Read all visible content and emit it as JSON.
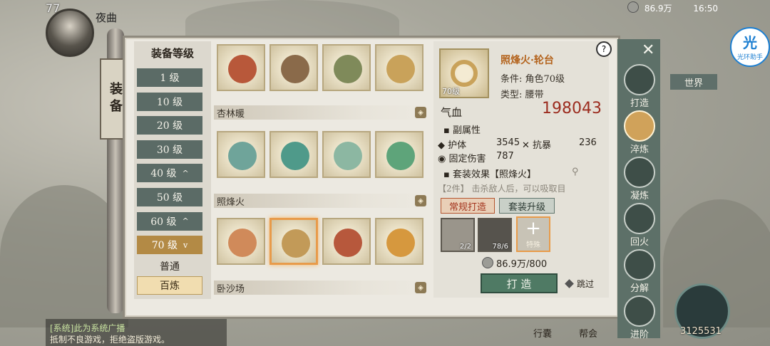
{
  "hud": {
    "player_level": "77",
    "player_name": "夜曲",
    "silver": "86.9万",
    "time": "16:50",
    "world_label": "世界",
    "helper_label": "光环助手",
    "helper_glyph": "光",
    "power_value": "3125531"
  },
  "scroll_tab": {
    "label": "装备"
  },
  "left_panel": {
    "title": "装备等级",
    "levels": [
      {
        "label": "1 级",
        "chevron": ""
      },
      {
        "label": "10 级",
        "chevron": ""
      },
      {
        "label": "20 级",
        "chevron": ""
      },
      {
        "label": "30 级",
        "chevron": ""
      },
      {
        "label": "40 级",
        "chevron": "^"
      },
      {
        "label": "50 级",
        "chevron": ""
      },
      {
        "label": "60 级",
        "chevron": "^"
      },
      {
        "label": "70 级",
        "chevron": "v"
      }
    ],
    "quality_label": "普通",
    "quality_selected": "百炼"
  },
  "sets": [
    {
      "name": "",
      "items": [
        "red-shoulder-armor",
        "bronze-belt",
        "green-boots",
        "gold-ring"
      ]
    },
    {
      "name": "杏林暖",
      "items": [
        "teal-robe",
        "teal-belt",
        "teal-boots",
        "jade-ring"
      ]
    },
    {
      "name": "照烽火",
      "items": [
        "orange-robe",
        "tassel-belt",
        "red-boots",
        "amber-ring"
      ]
    },
    {
      "name": "卧沙场",
      "items": []
    }
  ],
  "detail": {
    "item_name": "照烽火·轮台",
    "condition": "条件: 角色70级",
    "type": "类型: 腰带",
    "item_level": "70级",
    "qixue_label": "气血",
    "qixue_value": "198043",
    "sub_attr_title": "副属性",
    "attrs": [
      {
        "name": "护体",
        "value": "3545"
      },
      {
        "name": "抗暴",
        "value": "236"
      },
      {
        "name": "固定伤害",
        "value": "787"
      }
    ],
    "set_effect_title": "套装效果【照烽火】",
    "set_effect_desc": "【2件】 击杀敌人后，可以吸取目",
    "tab_normal": "常规打造",
    "tab_upgrade": "套装升级",
    "materials": [
      {
        "name": "iron-ingot",
        "count": "2/2"
      },
      {
        "name": "ore-stone",
        "count": "78/6"
      }
    ],
    "special_label": "特殊",
    "cost": "86.9万/800",
    "forge_button": "打 造",
    "skip_label": "跳过"
  },
  "side_menu": [
    {
      "label": "打造",
      "active": false
    },
    {
      "label": "淬炼",
      "active": true
    },
    {
      "label": "凝炼",
      "active": false
    },
    {
      "label": "回火",
      "active": false
    },
    {
      "label": "分解",
      "active": false
    },
    {
      "label": "进阶",
      "active": false
    }
  ],
  "chat": {
    "line1": "[系统]此为系统广播",
    "line2": "抵制不良游戏，拒绝盗版游戏。"
  },
  "bottom_labels": {
    "left": "行囊",
    "right": "帮会"
  },
  "colors": {
    "accent_orange": "#e89b4a",
    "qixue_red": "#9c2c1f",
    "forge_green": "#4f7a64"
  }
}
